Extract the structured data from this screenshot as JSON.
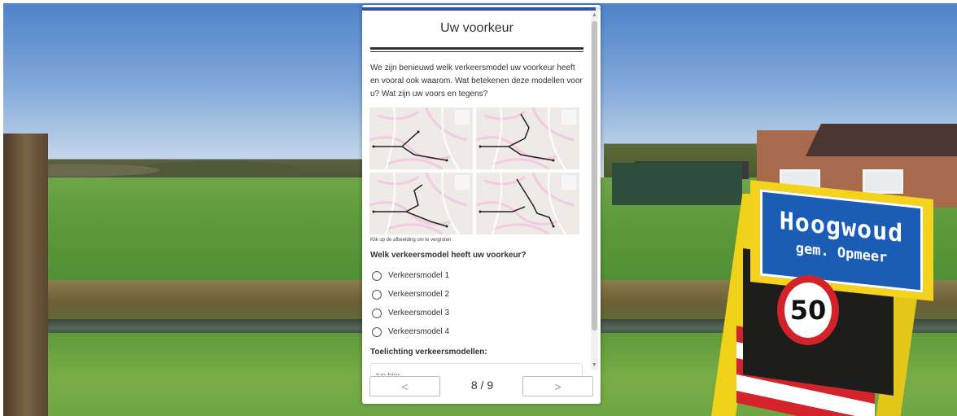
{
  "scene": {
    "sign": {
      "town": "Hoogwoud",
      "municipality": "gem. Opmeer",
      "speed_limit": "50"
    }
  },
  "survey": {
    "progress_fraction": 0.98,
    "title": "Uw voorkeur",
    "intro": "We zijn benieuwd welk verkeersmodel uw voorkeur heeft en vooral ook waarom. Wat betekenen deze modellen voor u? Wat zijn uw voors en tegens?",
    "image_caption": "Klik op de afbeelding om te vergroten",
    "question": "Welk verkeersmodel heeft uw voorkeur?",
    "options": [
      {
        "label": "Verkeersmodel 1"
      },
      {
        "label": "Verkeersmodel 2"
      },
      {
        "label": "Verkeersmodel 3"
      },
      {
        "label": "Verkeersmodel 4"
      }
    ],
    "comment_label": "Toelichting verkeersmodellen:",
    "comment_placeholder": "typ hier...",
    "nav": {
      "prev_icon": "chevron-left-icon",
      "prev_label": "<",
      "next_icon": "chevron-right-icon",
      "next_label": ">",
      "page_counter": "8 / 9"
    }
  }
}
